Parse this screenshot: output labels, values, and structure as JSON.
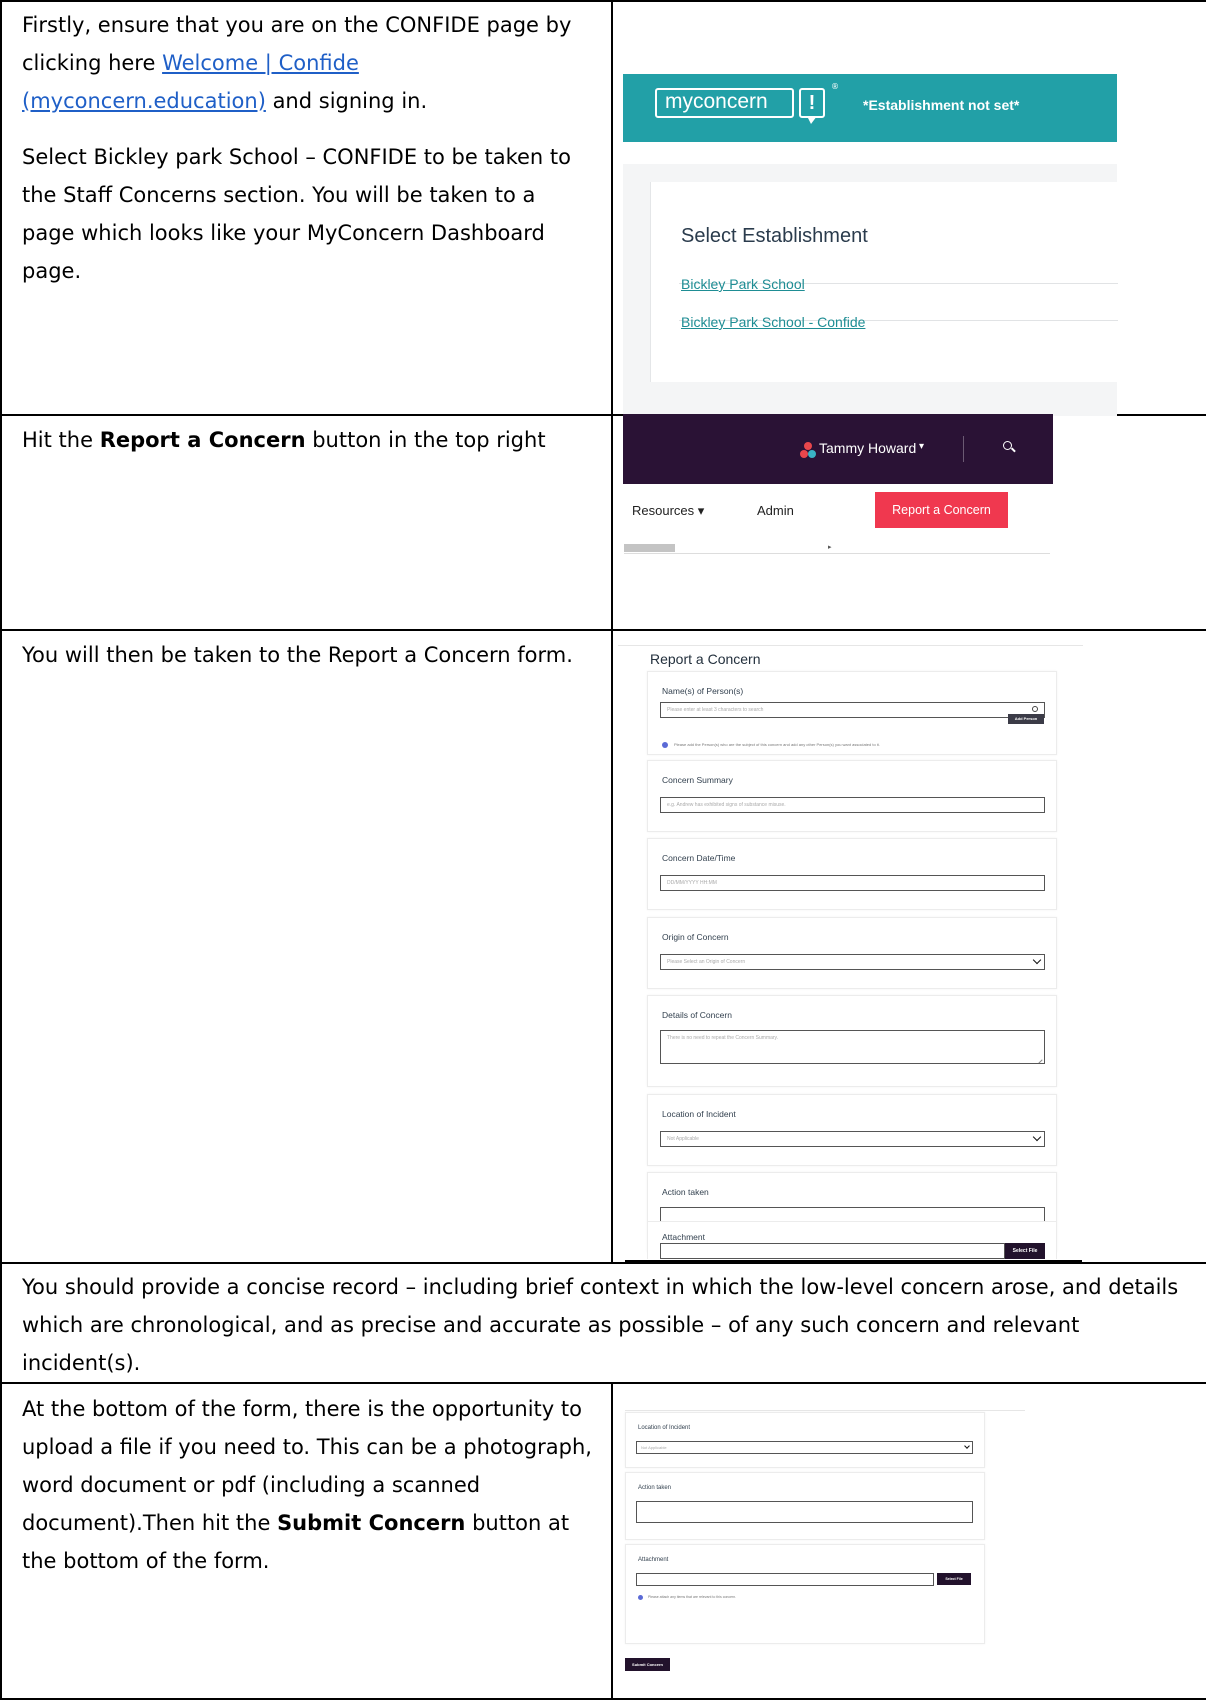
{
  "rows": [
    {
      "para1_pre": "Firstly, ensure that you are on the CONFIDE page by clicking here ",
      "para1_link": "Welcome | Confide (myconcern.education)",
      "para1_post": " and signing in.",
      "para2": "Select Bickley park School – CONFIDE to be taken to the Staff Concerns section. You will be taken to a page which looks like your MyConcern Dashboard page."
    },
    {
      "pre": "Hit the ",
      "bold": "Report a Concern",
      "post": " button in the top right"
    },
    {
      "text": "You will then be taken to the Report a Concern form."
    },
    {
      "text": "You should provide a concise record – including brief context in which the low-level concern arose, and details which are chronological, and as precise and accurate as possible – of any such concern and relevant incident(s)."
    },
    {
      "pre": "At the bottom of the form, there is the opportunity to upload a file if you need to. This can be a photograph, word document or pdf (including a scanned document).Then hit the ",
      "bold": "Submit Concern",
      "post": " button at the bottom of the form."
    }
  ],
  "shot1": {
    "logo_text": "myconcern",
    "logo_bang": "!",
    "logo_reg": "®",
    "establishment_banner": "*Establishment not set*",
    "title": "Select Establishment",
    "links": [
      "Bickley Park School",
      "Bickley Park School - Confide"
    ]
  },
  "shot2": {
    "user_name": "Tammy Howard",
    "user_caret": "▾",
    "nav_resources": "Resources ▾",
    "nav_admin": "Admin",
    "report_button": "Report a Concern",
    "scroll_arrow": "▸"
  },
  "shot3": {
    "heading": "Report a Concern",
    "names_label": "Name(s) of Person(s)",
    "names_placeholder": "Please enter at least 3 characters to search",
    "add_person": "Add Person",
    "names_hint": "Please add the Person(s) who are the subject of this concern and add any other Person(s) you want associated to it.",
    "summary_label": "Concern Summary",
    "summary_placeholder": "e.g. Andrew has exhibited signs of substance misuse.",
    "datetime_label": "Concern Date/Time",
    "datetime_placeholder": "DD/MM/YYYY HH:MM",
    "origin_label": "Origin of Concern",
    "origin_value": "Please Select an Origin of Concern",
    "details_label": "Details of Concern",
    "details_placeholder": "There is no need to repeat the Concern Summary.",
    "location_label": "Location of Incident",
    "location_value": "Not Applicable",
    "action_label": "Action taken",
    "attachment_label": "Attachment",
    "select_file": "Select File"
  },
  "shot4": {
    "location_label": "Location of Incident",
    "location_value": "Not Applicable",
    "action_label": "Action taken",
    "attachment_label": "Attachment",
    "select_file": "Select File",
    "attachment_hint": "Please attach any items that are relevant to this concern.",
    "submit": "Submit Concern"
  }
}
